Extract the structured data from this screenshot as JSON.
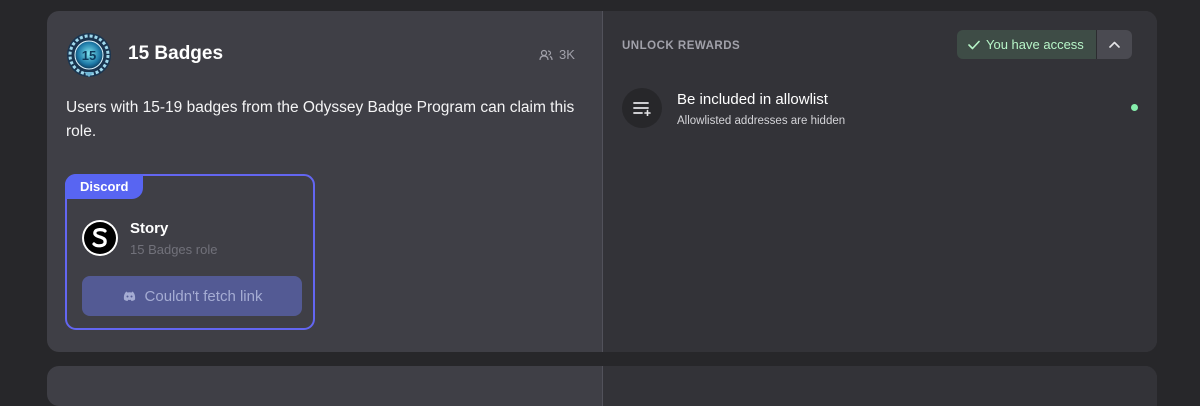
{
  "role": {
    "title": "15 Badges",
    "badge_number": "15",
    "member_count": "3K",
    "description": "Users with 15-19 badges from the Odyssey Badge Program can claim this role."
  },
  "reward": {
    "platform": "Discord",
    "server_name": "Story",
    "role_label": "15 Badges role",
    "button_label": "Couldn't fetch link"
  },
  "unlock": {
    "section_label": "UNLOCK REWARDS",
    "access_label": "You have access",
    "item_title": "Be included in allowlist",
    "item_subtitle": "Allowlisted addresses are hidden"
  },
  "colors": {
    "accent": "#5865f2",
    "access_green": "#b7f5c8",
    "status_dot": "#86efac"
  }
}
